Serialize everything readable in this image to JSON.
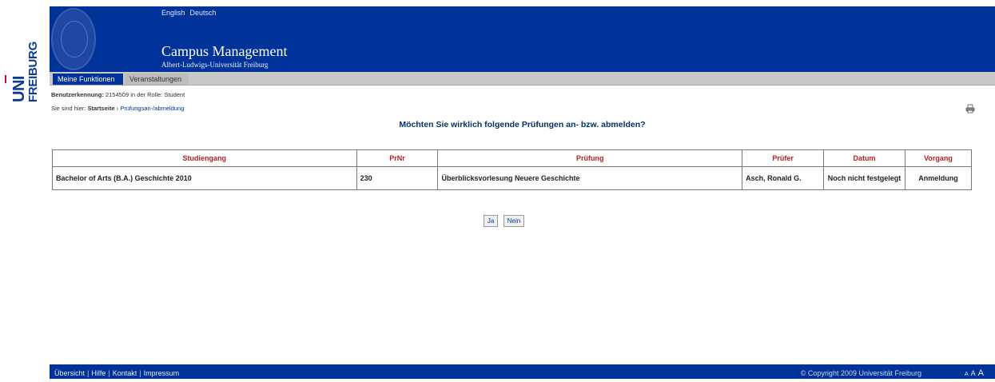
{
  "logo": {
    "uni": "UNI",
    "freiburg": "FREIBURG"
  },
  "header": {
    "languages": [
      "English",
      "Deutsch"
    ],
    "title": "Campus Management",
    "subtitle": "Albert-Ludwigs-Universität Freiburg"
  },
  "nav": {
    "tabs": [
      "Meine Funktionen",
      "Veranstaltungen"
    ],
    "active": 0
  },
  "user": {
    "label": "Benutzerkennung:",
    "id": "2154509",
    "role_text": "in der Rolle: Student"
  },
  "breadcrumb": {
    "prefix": "Sie sind hier:",
    "home": "Startseite",
    "separator": "›",
    "current": "Prüfungsan-/abmeldung"
  },
  "question": "Möchten Sie wirklich folgende Prüfungen an- bzw. abmelden?",
  "table": {
    "headers": [
      "Studiengang",
      "PrNr",
      "Prüfung",
      "Prüfer",
      "Datum",
      "Vorgang"
    ],
    "rows": [
      [
        "Bachelor of Arts (B.A.) Geschichte 2010",
        "230",
        "Überblicksvorlesung Neuere Geschichte",
        "Asch, Ronald G.",
        "Noch nicht festgelegt",
        "Anmeldung"
      ]
    ]
  },
  "buttons": {
    "yes": "Ja",
    "no": "Nein"
  },
  "footer": {
    "links": [
      "Übersicht",
      "Hilfe",
      "Kontakt",
      "Impressum"
    ],
    "separator": "|",
    "copyright": "© Copyright 2009 Universität Freiburg",
    "font_sizes": [
      "A",
      "A",
      "A"
    ]
  },
  "colors": {
    "brand_blue": "#003399",
    "header_text": "#b22222",
    "logo_red": "#c8102e"
  },
  "icons": {
    "print": "printer-icon"
  }
}
